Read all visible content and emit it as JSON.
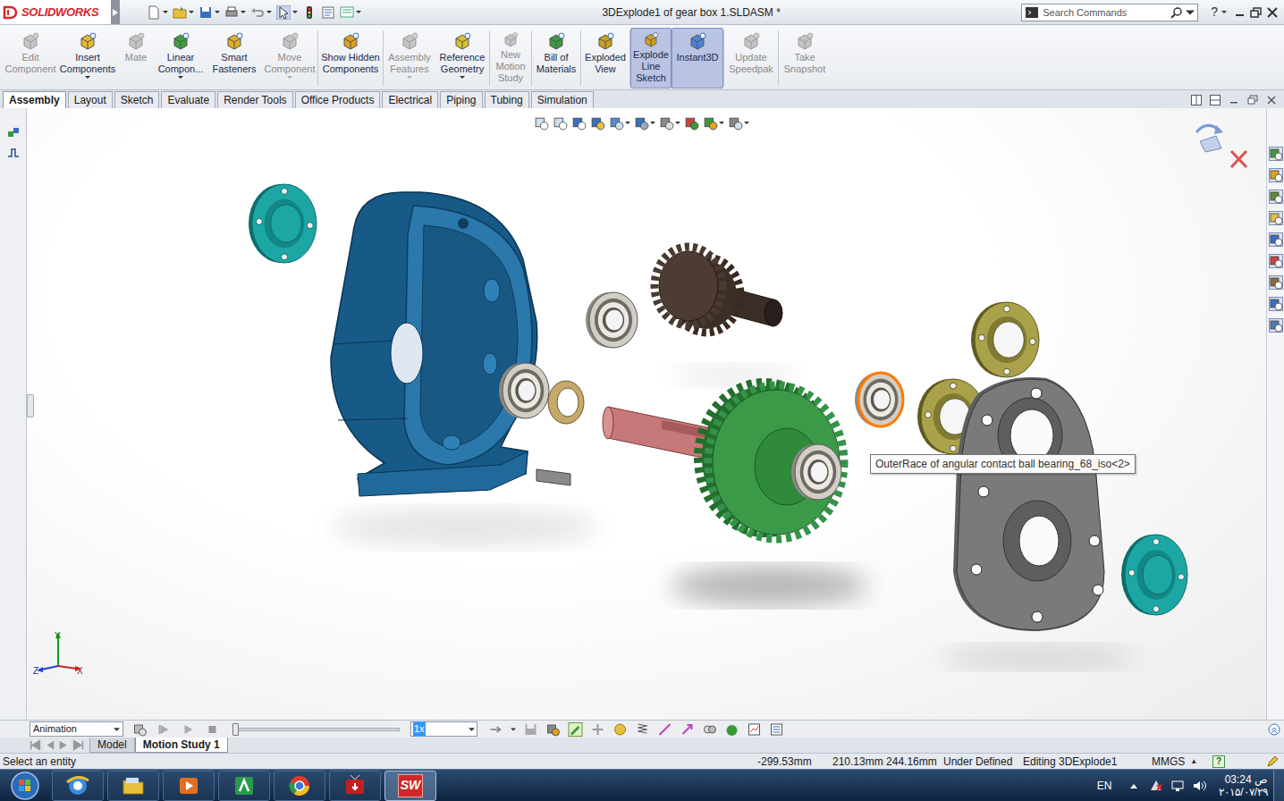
{
  "window": {
    "app": "SOLIDWORKS",
    "title": "3DExplode1 of gear box 1.SLDASM *"
  },
  "search": {
    "placeholder": "Search Commands"
  },
  "help": "?",
  "commands": [
    {
      "label": "Edit Component",
      "disabled": true,
      "selected": false,
      "has_menu": false
    },
    {
      "label": "Insert Components",
      "disabled": false,
      "selected": false,
      "has_menu": true
    },
    {
      "label": "Mate",
      "disabled": true,
      "selected": false,
      "has_menu": false
    },
    {
      "label": "Linear Compon...",
      "disabled": false,
      "selected": false,
      "has_menu": true
    },
    {
      "label": "Smart Fasteners",
      "disabled": false,
      "selected": false,
      "has_menu": false
    },
    {
      "label": "Move Component",
      "disabled": true,
      "selected": false,
      "has_menu": true
    },
    {
      "label": "Show Hidden Components",
      "disabled": false,
      "selected": false,
      "has_menu": false
    },
    {
      "label": "Assembly Features",
      "disabled": true,
      "selected": false,
      "has_menu": true
    },
    {
      "label": "Reference Geometry",
      "disabled": false,
      "selected": false,
      "has_menu": true
    },
    {
      "label": "New Motion Study",
      "disabled": true,
      "selected": false,
      "has_menu": false
    },
    {
      "label": "Bill of Materials",
      "disabled": false,
      "selected": false,
      "has_menu": false
    },
    {
      "label": "Exploded View",
      "disabled": false,
      "selected": false,
      "has_menu": false
    },
    {
      "label": "Explode Line Sketch",
      "disabled": false,
      "selected": true,
      "has_menu": false
    },
    {
      "label": "Instant3D",
      "disabled": false,
      "selected": true,
      "has_menu": false
    },
    {
      "label": "Update Speedpak",
      "disabled": true,
      "selected": false,
      "has_menu": false
    },
    {
      "label": "Take Snapshot",
      "disabled": true,
      "selected": false,
      "has_menu": false
    }
  ],
  "tabs": [
    {
      "label": "Assembly",
      "selected": true
    },
    {
      "label": "Layout",
      "selected": false
    },
    {
      "label": "Sketch",
      "selected": false
    },
    {
      "label": "Evaluate",
      "selected": false
    },
    {
      "label": "Render Tools",
      "selected": false
    },
    {
      "label": "Office Products",
      "selected": false
    },
    {
      "label": "Electrical",
      "selected": false
    },
    {
      "label": "Piping",
      "selected": false
    },
    {
      "label": "Tubing",
      "selected": false
    },
    {
      "label": "Simulation",
      "selected": false
    }
  ],
  "tooltip": "OuterRace of angular contact ball bearing_68_iso<2>",
  "triad": {
    "x": "X",
    "y": "Y",
    "z": "Z"
  },
  "motion": {
    "study_type": "Animation",
    "timeline_level": 0,
    "speed": "1x"
  },
  "study_tabs": [
    {
      "label": "Model",
      "selected": false
    },
    {
      "label": "Motion Study 1",
      "selected": true
    }
  ],
  "status_bar": {
    "message": "Select an entity",
    "x": "-299.53mm",
    "coords": "210.13mm 244.16mm",
    "state": "Under Defined",
    "editing": "Editing 3DExplode1",
    "units": "MMGS",
    "units_caret": "▲",
    "help": "?"
  },
  "taskbar": {
    "apps": [
      {
        "selected": false
      },
      {
        "selected": false
      },
      {
        "selected": false
      },
      {
        "selected": false
      },
      {
        "selected": false
      },
      {
        "selected": false
      },
      {
        "label": "SW",
        "selected": true
      }
    ],
    "language": "EN",
    "time": "03:24 ص",
    "date": "۲۰۱۵/۰۷/۲۹"
  }
}
